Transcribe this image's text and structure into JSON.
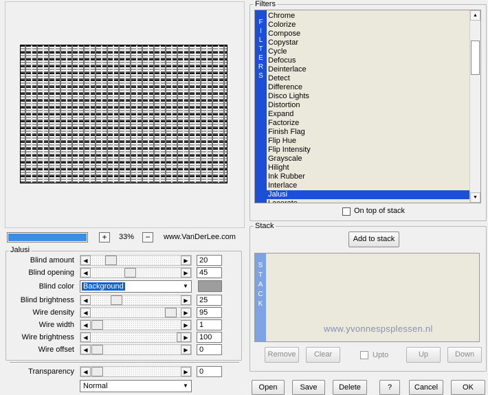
{
  "preview": {
    "progress_percent": 100,
    "zoom_in_label": "+",
    "zoom_value": "33%",
    "zoom_out_label": "−",
    "website": "www.VanDerLee.com"
  },
  "filter_params": {
    "group_title": "Jalusi",
    "sliders": [
      {
        "label": "Blind amount",
        "value": "20"
      },
      {
        "label": "Blind opening",
        "value": "45"
      },
      {
        "label": "Blind brightness",
        "value": "25"
      },
      {
        "label": "Wire density",
        "value": "95"
      },
      {
        "label": "Wire width",
        "value": "1"
      },
      {
        "label": "Wire brightness",
        "value": "100"
      },
      {
        "label": "Wire offset",
        "value": "0"
      }
    ],
    "blind_color": {
      "label": "Blind color",
      "selected": "Background",
      "swatch": "#9d9d9d"
    },
    "transparency": {
      "label": "Transparency",
      "value": "0"
    },
    "blend_mode": "Normal"
  },
  "filters": {
    "group_title": "Filters",
    "strip_letters": [
      "F",
      "I",
      "L",
      "T",
      "E",
      "R",
      "S"
    ],
    "items": [
      "Chrome",
      "Colorize",
      "Compose",
      "Copystar",
      "Cycle",
      "Defocus",
      "Deinterlace",
      "Detect",
      "Difference",
      "Disco Lights",
      "Distortion",
      "Expand",
      "Factorize",
      "Finish Flag",
      "Flip Hue",
      "Flip Intensity",
      "Grayscale",
      "Hilight",
      "Ink Rubber",
      "Interlace",
      "Jalusi",
      "Lacerate"
    ],
    "selected": "Jalusi",
    "on_top_label": "On top of stack"
  },
  "stack": {
    "group_title": "Stack",
    "add_label": "Add to stack",
    "strip_letters": [
      "S",
      "T",
      "A",
      "C",
      "K"
    ],
    "watermark": "www.yvonnespsplessen.nl",
    "remove_label": "Remove",
    "clear_label": "Clear",
    "upto_label": "Upto",
    "up_label": "Up",
    "down_label": "Down"
  },
  "footer": {
    "open": "Open",
    "save": "Save",
    "delete": "Delete",
    "help": "?",
    "cancel": "Cancel",
    "ok": "OK"
  },
  "colors": {
    "accent": "#1a4fd6",
    "stack_strip": "#7da3e4",
    "list_bg": "#ebe9dc"
  }
}
